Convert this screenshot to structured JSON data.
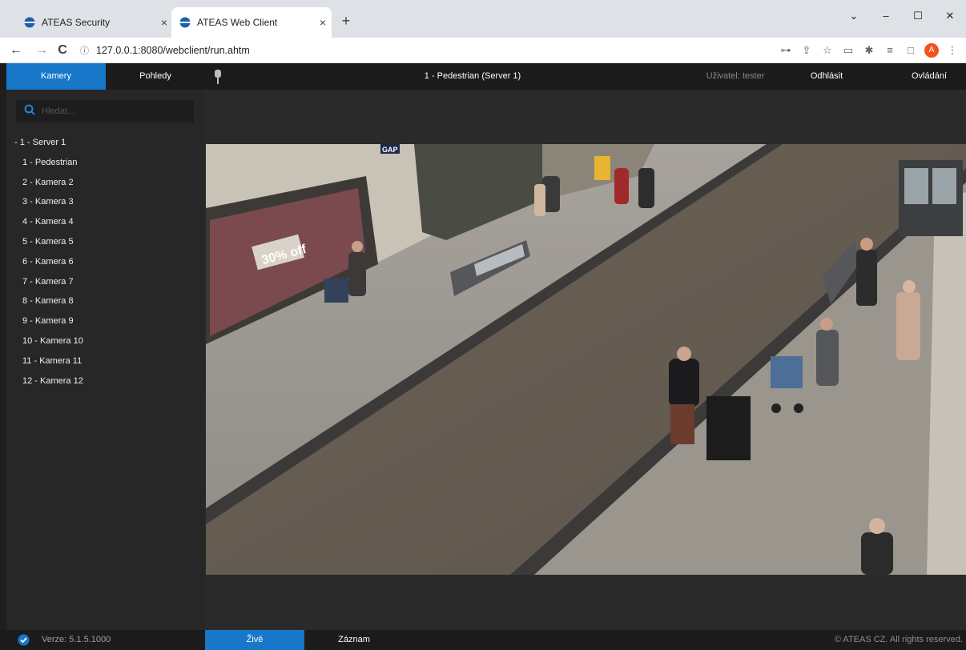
{
  "browser": {
    "tabs": [
      {
        "title": "ATEAS Security",
        "active": false
      },
      {
        "title": "ATEAS Web Client",
        "active": true
      }
    ],
    "new_tab": "+",
    "close_glyph": "×",
    "url": "127.0.0.1:8080/webclient/run.ahtm",
    "nav": {
      "back": "←",
      "forward": "→",
      "reload": "C"
    },
    "window": {
      "tablist": "⌄",
      "minimize": "–",
      "maximize": "☐",
      "close": "✕"
    },
    "toolbar_icons": [
      "key-icon",
      "share-icon",
      "star-icon",
      "cast-icon",
      "extensions-icon",
      "reading-list-icon",
      "sidepanel-icon",
      "profile-avatar",
      "menu-icon"
    ],
    "avatar_letter": "A"
  },
  "app": {
    "tabs": {
      "cameras": "Kamery",
      "views": "Pohledy"
    },
    "camera_title": "1 - Pedestrian (Server 1)",
    "user": "Uživatel: tester",
    "logout": "Odhlásit",
    "control": "Ovládání",
    "accent": "#1877c9"
  },
  "sidebar": {
    "search_placeholder": "Hledat...",
    "server": "-  1 - Server 1",
    "cameras": [
      "1 - Pedestrian",
      "2 - Kamera 2",
      "3 - Kamera 3",
      "4 - Kamera 4",
      "5 - Kamera 5",
      "6 - Kamera 6",
      "7 - Kamera 7",
      "8 - Kamera 8",
      "9 - Kamera 9",
      "10 - Kamera 10",
      "11 - Kamera 11",
      "12 - Kamera 12"
    ]
  },
  "video": {
    "sign_sale": "30% off",
    "sign_shop": "GAP"
  },
  "status": {
    "version": "Verze: 5.1.5.1000",
    "live": "Živě",
    "record": "Záznam",
    "copyright": "© ATEAS CZ. All rights reserved."
  }
}
